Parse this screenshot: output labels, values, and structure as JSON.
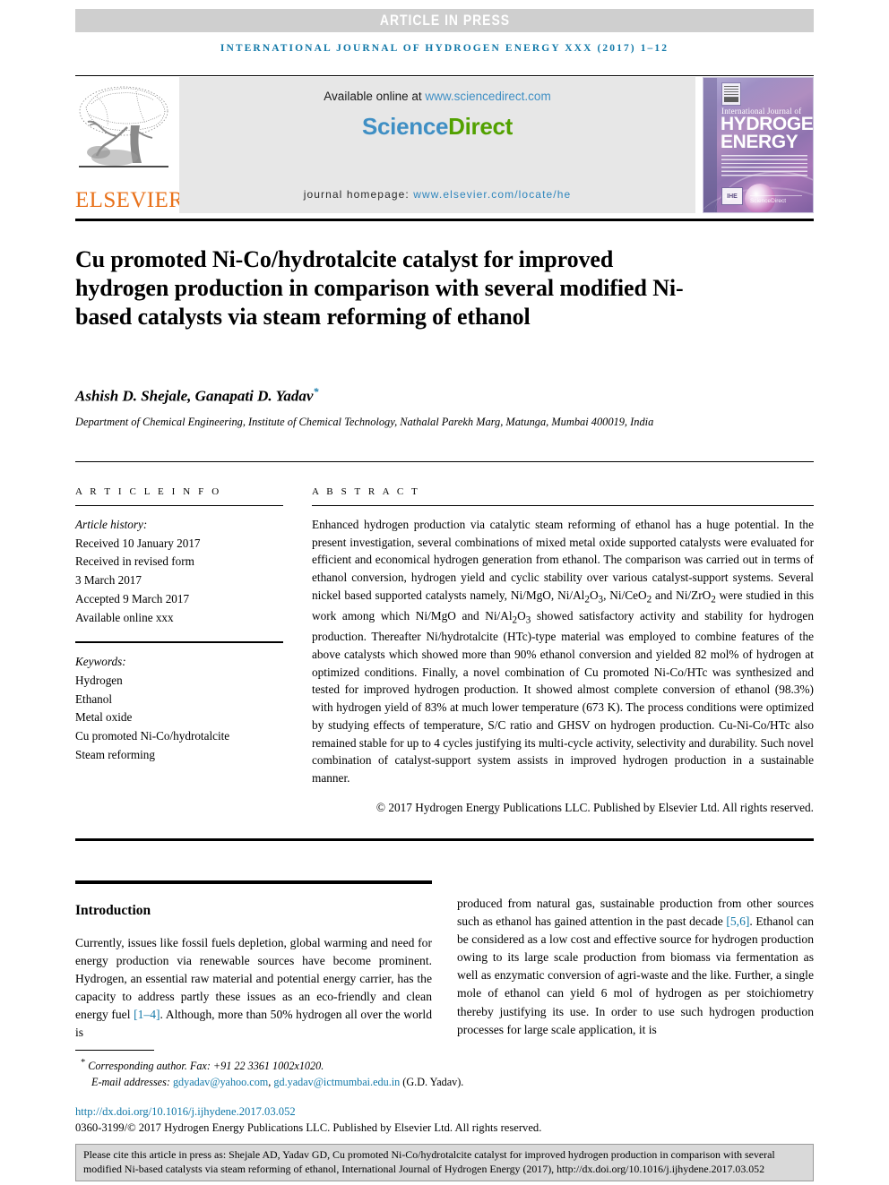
{
  "banner": {
    "article_in_press": "ARTICLE IN PRESS",
    "running_head": "INTERNATIONAL JOURNAL OF HYDROGEN ENERGY XXX (2017) 1–12"
  },
  "header": {
    "elsevier_wordmark": "ELSEVIER",
    "available_prefix": "Available online at ",
    "available_url": "www.sciencedirect.com",
    "wordmark_science": "Science",
    "wordmark_direct": "Direct",
    "homepage_prefix": "journal homepage: ",
    "homepage_url": "www.elsevier.com/locate/he",
    "cover": {
      "line_international": "International Journal of",
      "line_hydrogen": "HYDROGEN",
      "line_energy": "ENERGY",
      "badge": "IHE",
      "sd_mini": "ScienceDirect"
    }
  },
  "article": {
    "title": "Cu promoted Ni-Co/hydrotalcite catalyst for improved hydrogen production in comparison with several modified Ni-based catalysts via steam reforming of ethanol",
    "authors": "Ashish D. Shejale, Ganapati D. Yadav",
    "author_footnote_marker": "*",
    "affiliation": "Department of Chemical Engineering, Institute of Chemical Technology, Nathalal Parekh Marg, Matunga, Mumbai 400019, India"
  },
  "article_info": {
    "label": "A R T I C L E   I N F O",
    "history_label": "Article history:",
    "history": [
      "Received 10 January 2017",
      "Received in revised form",
      "3 March 2017",
      "Accepted 9 March 2017",
      "Available online xxx"
    ],
    "keywords_label": "Keywords:",
    "keywords": [
      "Hydrogen",
      "Ethanol",
      "Metal oxide",
      "Cu promoted Ni-Co/hydrotalcite",
      "Steam reforming"
    ]
  },
  "abstract": {
    "label": "A B S T R A C T",
    "paragraph_parts": [
      "Enhanced hydrogen production via catalytic steam reforming of ethanol has a huge potential. In the present investigation, several combinations of mixed metal oxide supported catalysts were evaluated for efficient and economical hydrogen generation from ethanol. The comparison was carried out in terms of ethanol conversion, hydrogen yield and cyclic stability over various catalyst-support systems. Several nickel based supported catalysts namely, Ni/MgO, Ni/Al",
      "2",
      "O",
      "3",
      ", Ni/CeO",
      "2",
      " and Ni/ZrO",
      "2",
      " were studied in this work among which Ni/MgO and Ni/Al",
      "2",
      "O",
      "3",
      " showed satisfactory activity and stability for hydrogen production. Thereafter Ni/hydrotalcite (HTc)-type material was employed to combine features of the above catalysts which showed more than 90% ethanol conversion and yielded 82 mol% of hydrogen at optimized conditions. Finally, a novel combination of Cu promoted Ni-Co/HTc was synthesized and tested for improved hydrogen production. It showed almost complete conversion of ethanol (98.3%) with hydrogen yield of 83% at much lower temperature (673 K). The process conditions were optimized by studying effects of temperature, S/C ratio and GHSV on hydrogen production. Cu-Ni-Co/HTc also remained stable for up to 4 cycles justifying its multi-cycle activity, selectivity and durability. Such novel combination of catalyst-support system assists in improved hydrogen production in a sustainable manner."
    ],
    "copyright": "© 2017 Hydrogen Energy Publications LLC. Published by Elsevier Ltd. All rights reserved."
  },
  "body": {
    "intro_heading": "Introduction",
    "left_column_before_ref": "Currently, issues like fossil fuels depletion, global warming and need for energy production via renewable sources have become prominent. Hydrogen, an essential raw material and potential energy carrier, has the capacity to address partly these issues as an eco-friendly and clean energy fuel ",
    "left_column_ref": "[1–4]",
    "left_column_after_ref": ". Although, more than 50% hydrogen all over the world is",
    "right_column_before_ref": "produced from natural gas, sustainable production from other sources such as ethanol has gained attention in the past decade ",
    "right_column_ref": "[5,6]",
    "right_column_after_ref": ". Ethanol can be considered as a low cost and effective source for hydrogen production owing to its large scale production from biomass via fermentation as well as enzymatic conversion of agri-waste and the like. Further, a single mole of ethanol can yield 6 mol of hydrogen as per stoichiometry thereby justifying its use. In order to use such hydrogen production processes for large scale application, it is"
  },
  "footnote": {
    "marker": "*",
    "corresponding": "Corresponding author.",
    "fax": " Fax: +91 22 3361 1002x1020.",
    "email_label": "E-mail addresses:",
    "email_1": "gdyadav@yahoo.com",
    "email_sep": ", ",
    "email_2": "gd.yadav@ictmumbai.edu.in",
    "email_suffix": " (G.D. Yadav).",
    "doi": "http://dx.doi.org/10.1016/j.ijhydene.2017.03.052",
    "issn": "0360-3199/© 2017 Hydrogen Energy Publications LLC. Published by Elsevier Ltd. All rights reserved."
  },
  "cite_box": {
    "text": "Please cite this article in press as: Shejale AD, Yadav GD, Cu promoted Ni-Co/hydrotalcite catalyst for improved hydrogen production in comparison with several modified Ni-based catalysts via steam reforming of ethanol, International Journal of Hydrogen Energy (2017), http://dx.doi.org/10.1016/j.ijhydene.2017.03.052"
  },
  "colors": {
    "link_blue": "#1178a8",
    "sd_green": "#52a100",
    "sd_blue": "#3f8fc4",
    "elsevier_orange": "#e8711a",
    "banner_grey": "#cfcfcf",
    "panel_grey": "#e7e7e7",
    "cite_box_grey": "#d9d9d9"
  }
}
